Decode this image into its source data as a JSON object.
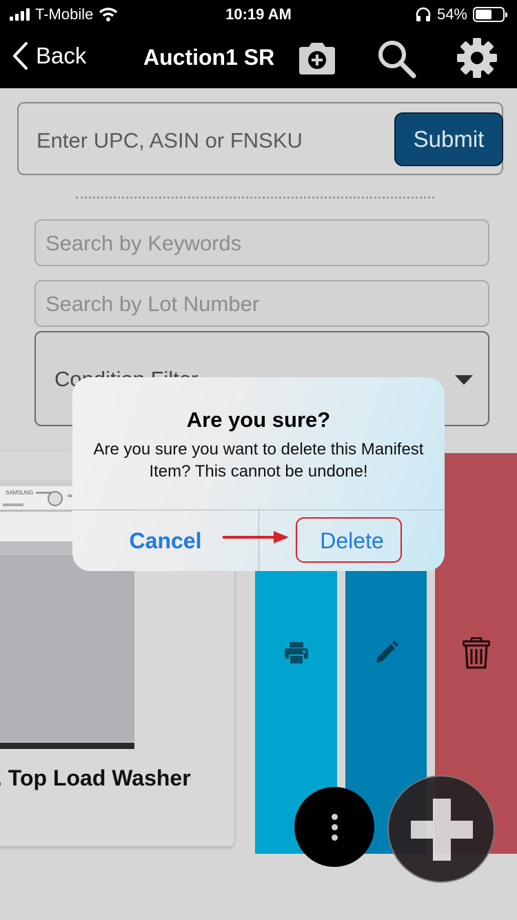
{
  "status_bar": {
    "carrier": "T-Mobile",
    "time": "10:19 AM",
    "battery": "54%"
  },
  "nav": {
    "back_label": "Back",
    "title": "Auction1 SR",
    "icons": [
      "camera-plus-icon",
      "search-icon",
      "gear-icon"
    ]
  },
  "upc": {
    "placeholder": "Enter UPC, ASIN or FNSKU",
    "submit_label": "Submit"
  },
  "filters": {
    "keywords_placeholder": "Search by Keywords",
    "lot_placeholder": "Search by Lot Number",
    "condition_label": "Condition Filter"
  },
  "card": {
    "title": ". Top Load Washer"
  },
  "actions": {
    "print_icon": "printer-icon",
    "edit_icon": "pencil-icon",
    "delete_icon": "trash-icon"
  },
  "alert": {
    "title": "Are you sure?",
    "message": "Are you sure you want to delete this Manifest Item? This cannot be undone!",
    "cancel_label": "Cancel",
    "delete_label": "Delete"
  },
  "colors": {
    "print_action": "#00a5cf",
    "edit_action": "#007fb2",
    "delete_action": "#b44d53",
    "alert_button": "#1d7ae0",
    "highlight": "#d8232a",
    "submit_button": "#0d4a73"
  }
}
